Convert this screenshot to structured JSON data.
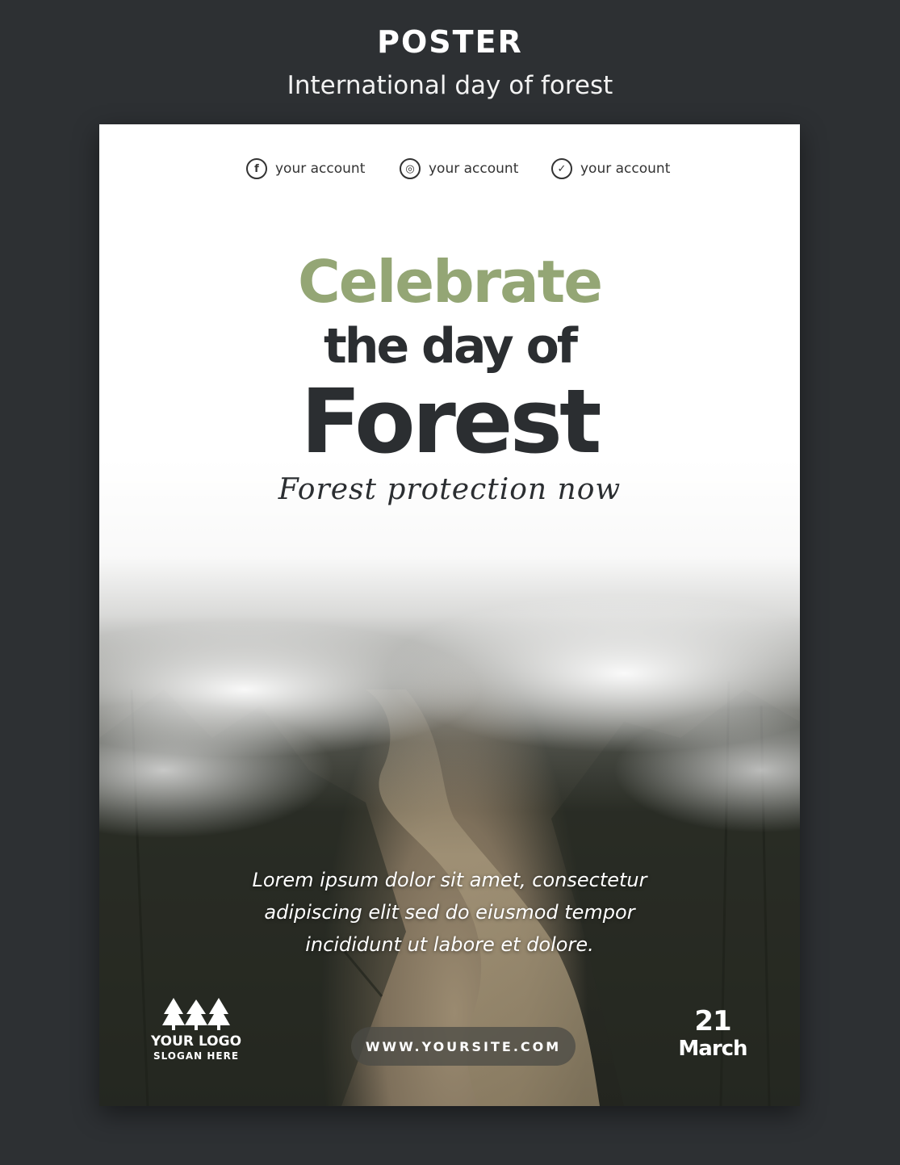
{
  "header": {
    "title": "POSTER",
    "subtitle": "International day of forest"
  },
  "social": [
    {
      "icon": "facebook-icon",
      "glyph": "f",
      "label": "your account"
    },
    {
      "icon": "instagram-icon",
      "glyph": "◎",
      "label": "your account"
    },
    {
      "icon": "twitter-icon",
      "glyph": "✓",
      "label": "your account"
    }
  ],
  "headline": {
    "line1": "Celebrate",
    "line2": "the day of",
    "line3": "Forest",
    "script": "Forest protection now"
  },
  "body": "Lorem ipsum dolor sit amet, consectetur adipiscing elit sed do eiusmod tempor incididunt ut labore et dolore.",
  "logo": {
    "name": "YOUR LOGO",
    "slogan": "SLOGAN HERE"
  },
  "website": "WWW.YOURSITE.COM",
  "date": {
    "day": "21",
    "month": "March"
  },
  "colors": {
    "background": "#2d3033",
    "accent_green": "#94a675",
    "dark_text": "#2b2e31"
  }
}
